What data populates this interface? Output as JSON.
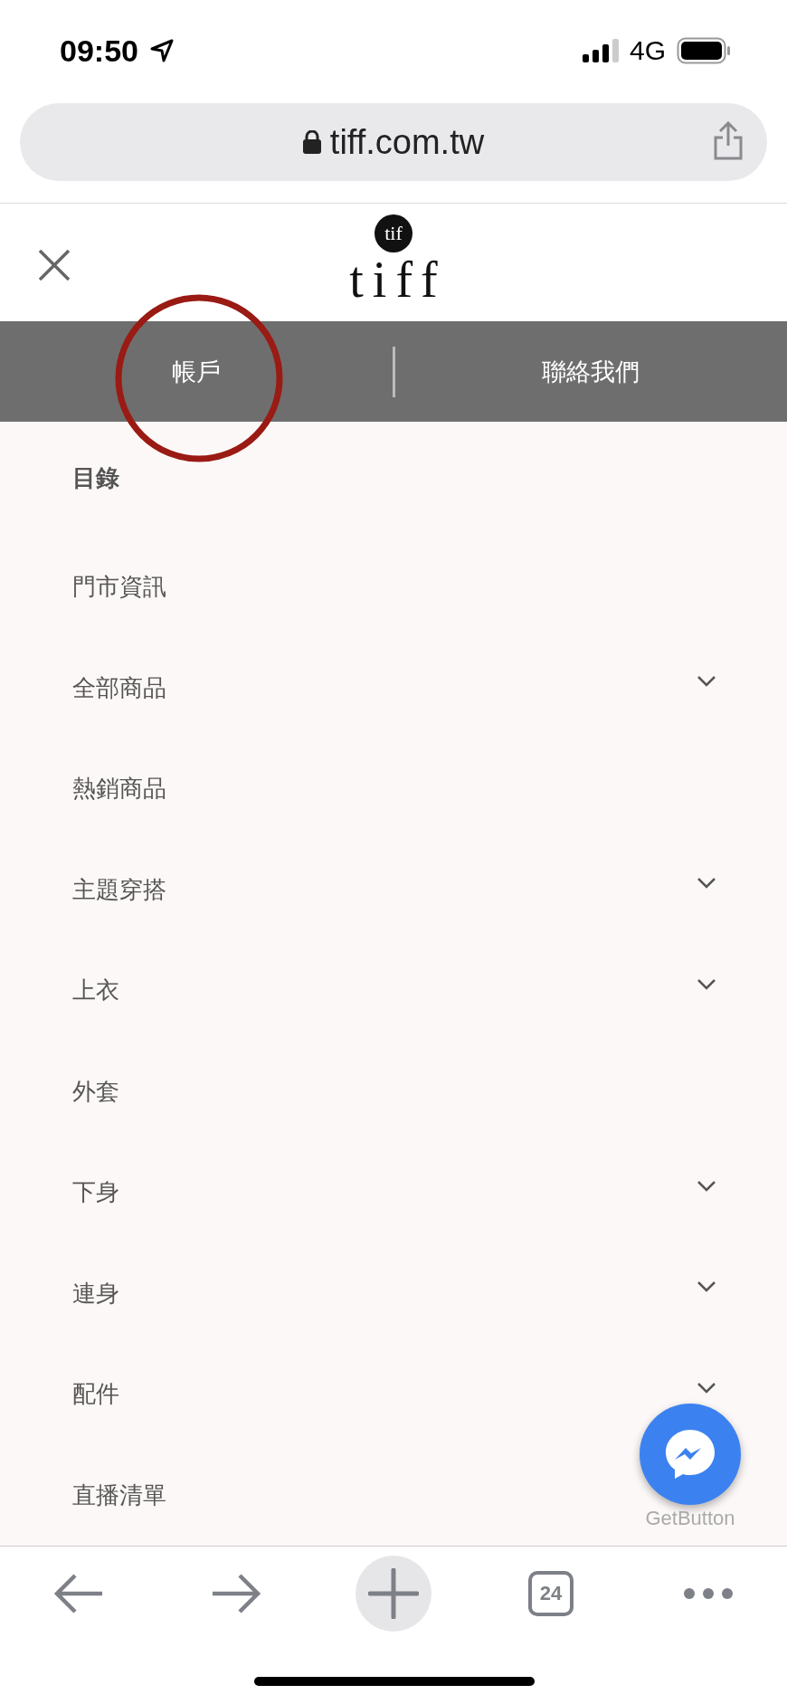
{
  "status_bar": {
    "time": "09:50",
    "network": "4G"
  },
  "address_bar": {
    "url": "tiff.com.tw"
  },
  "header": {
    "logo_badge": "tif",
    "logo_text": "tiff"
  },
  "account_bar": {
    "items": [
      {
        "label": "帳戶",
        "highlighted": true
      },
      {
        "label": "聯絡我們",
        "highlighted": false
      }
    ]
  },
  "menu": {
    "heading": "目錄",
    "items": [
      {
        "label": "門市資訊",
        "expandable": false
      },
      {
        "label": "全部商品",
        "expandable": true
      },
      {
        "label": "熱銷商品",
        "expandable": false
      },
      {
        "label": "主題穿搭",
        "expandable": true
      },
      {
        "label": "上衣",
        "expandable": true
      },
      {
        "label": "外套",
        "expandable": false
      },
      {
        "label": "下身",
        "expandable": true
      },
      {
        "label": "連身",
        "expandable": true
      },
      {
        "label": "配件",
        "expandable": true
      },
      {
        "label": "直播清單",
        "expandable": false
      }
    ]
  },
  "chat_widget": {
    "caption": "GetButton"
  },
  "browser_toolbar": {
    "tab_count": "24"
  }
}
